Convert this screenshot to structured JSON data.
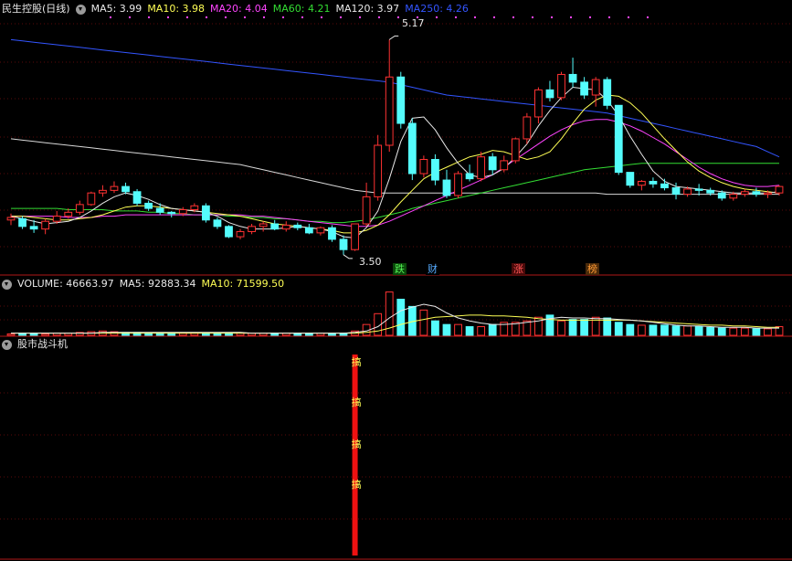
{
  "price_panel": {
    "title": "民生控股(日线)",
    "indicators": [
      {
        "name": "MA5",
        "value": "3.99",
        "color": "#e8e8e8"
      },
      {
        "name": "MA10",
        "value": "3.98",
        "color": "#ffff55"
      },
      {
        "name": "MA20",
        "value": "4.04",
        "color": "#ff44ff"
      },
      {
        "name": "MA60",
        "value": "4.21",
        "color": "#33dd33"
      },
      {
        "name": "MA120",
        "value": "3.97",
        "color": "#e8e8e8"
      },
      {
        "name": "MA250",
        "value": "4.26",
        "color": "#3355ff"
      }
    ],
    "high_marker": "5.17",
    "low_marker": "3.50",
    "event_badges": [
      {
        "text": "跌",
        "color": "#55ee55",
        "bg": "#0a4a0a"
      },
      {
        "text": "财",
        "color": "#55aaff",
        "bg": "#000"
      },
      {
        "text": "涨",
        "color": "#ff5555",
        "bg": "#4a0a0a"
      },
      {
        "text": "榜",
        "color": "#ff9933",
        "bg": "#4a2a0a"
      }
    ]
  },
  "volume_panel": {
    "indicators": [
      {
        "name": "VOLUME",
        "value": "46663.97",
        "color": "#e8e8e8"
      },
      {
        "name": "MA5",
        "value": "92883.34",
        "color": "#e8e8e8"
      },
      {
        "name": "MA10",
        "value": "71599.50",
        "color": "#ffff55"
      }
    ]
  },
  "custom_panel": {
    "title": "股市战斗机",
    "signal_text": "搞"
  },
  "chart_data": {
    "type": "candlestick",
    "ylim": [
      3.35,
      5.35
    ],
    "candles": [
      [
        3.77,
        3.82,
        3.73,
        3.79
      ],
      [
        3.78,
        3.8,
        3.7,
        3.72
      ],
      [
        3.72,
        3.77,
        3.67,
        3.7
      ],
      [
        3.7,
        3.78,
        3.66,
        3.76
      ],
      [
        3.76,
        3.84,
        3.74,
        3.8
      ],
      [
        3.8,
        3.86,
        3.78,
        3.83
      ],
      [
        3.83,
        3.92,
        3.81,
        3.89
      ],
      [
        3.89,
        3.99,
        3.88,
        3.98
      ],
      [
        3.98,
        4.04,
        3.95,
        4.0
      ],
      [
        4.0,
        4.07,
        3.98,
        4.03
      ],
      [
        4.03,
        4.06,
        3.97,
        3.99
      ],
      [
        3.99,
        4.01,
        3.88,
        3.9
      ],
      [
        3.9,
        3.92,
        3.84,
        3.86
      ],
      [
        3.86,
        3.9,
        3.81,
        3.83
      ],
      [
        3.83,
        3.84,
        3.79,
        3.82
      ],
      [
        3.82,
        3.87,
        3.8,
        3.85
      ],
      [
        3.85,
        3.9,
        3.83,
        3.88
      ],
      [
        3.88,
        3.9,
        3.75,
        3.77
      ],
      [
        3.77,
        3.79,
        3.7,
        3.72
      ],
      [
        3.72,
        3.73,
        3.63,
        3.64
      ],
      [
        3.64,
        3.7,
        3.62,
        3.68
      ],
      [
        3.68,
        3.74,
        3.66,
        3.72
      ],
      [
        3.72,
        3.76,
        3.68,
        3.74
      ],
      [
        3.74,
        3.77,
        3.69,
        3.7
      ],
      [
        3.7,
        3.76,
        3.68,
        3.73
      ],
      [
        3.73,
        3.75,
        3.69,
        3.71
      ],
      [
        3.71,
        3.74,
        3.66,
        3.67
      ],
      [
        3.67,
        3.72,
        3.65,
        3.71
      ],
      [
        3.71,
        3.73,
        3.6,
        3.62
      ],
      [
        3.62,
        3.65,
        3.5,
        3.54
      ],
      [
        3.54,
        3.74,
        3.53,
        3.74
      ],
      [
        3.74,
        4.06,
        3.72,
        3.95
      ],
      [
        3.95,
        4.43,
        3.92,
        4.35
      ],
      [
        4.35,
        5.17,
        4.3,
        4.88
      ],
      [
        4.88,
        4.92,
        4.48,
        4.52
      ],
      [
        4.52,
        4.56,
        4.08,
        4.13
      ],
      [
        4.13,
        4.27,
        4.1,
        4.24
      ],
      [
        4.24,
        4.28,
        4.04,
        4.08
      ],
      [
        4.08,
        4.16,
        3.94,
        3.96
      ],
      [
        3.96,
        4.15,
        3.94,
        4.13
      ],
      [
        4.13,
        4.2,
        4.07,
        4.09
      ],
      [
        4.09,
        4.3,
        4.07,
        4.26
      ],
      [
        4.26,
        4.29,
        4.12,
        4.16
      ],
      [
        4.16,
        4.27,
        4.14,
        4.23
      ],
      [
        4.23,
        4.41,
        4.21,
        4.4
      ],
      [
        4.4,
        4.6,
        4.36,
        4.57
      ],
      [
        4.57,
        4.8,
        4.52,
        4.78
      ],
      [
        4.78,
        4.85,
        4.69,
        4.72
      ],
      [
        4.72,
        4.92,
        4.7,
        4.9
      ],
      [
        4.9,
        5.03,
        4.8,
        4.84
      ],
      [
        4.84,
        4.88,
        4.71,
        4.74
      ],
      [
        4.74,
        4.88,
        4.65,
        4.86
      ],
      [
        4.86,
        4.88,
        4.63,
        4.66
      ],
      [
        4.66,
        4.2,
        4.12,
        4.14
      ],
      [
        4.14,
        4.14,
        4.02,
        4.04
      ],
      [
        4.04,
        4.08,
        4.0,
        4.07
      ],
      [
        4.07,
        4.1,
        4.02,
        4.05
      ],
      [
        4.05,
        4.09,
        4.0,
        4.02
      ],
      [
        4.02,
        4.06,
        3.93,
        3.97
      ],
      [
        3.97,
        4.03,
        3.95,
        4.01
      ],
      [
        4.01,
        4.05,
        3.96,
        4.0
      ],
      [
        4.0,
        4.02,
        3.96,
        3.98
      ],
      [
        3.98,
        4.0,
        3.92,
        3.94
      ],
      [
        3.94,
        3.99,
        3.92,
        3.97
      ],
      [
        3.97,
        4.01,
        3.95,
        3.99
      ],
      [
        3.99,
        4.02,
        3.95,
        3.97
      ],
      [
        3.97,
        4.0,
        3.94,
        3.98
      ],
      [
        3.98,
        4.04,
        3.96,
        4.03
      ]
    ],
    "ma5": [
      3.8,
      3.78,
      3.76,
      3.74,
      3.75,
      3.76,
      3.79,
      3.84,
      3.9,
      3.95,
      3.98,
      3.96,
      3.93,
      3.89,
      3.86,
      3.85,
      3.84,
      3.83,
      3.8,
      3.75,
      3.72,
      3.7,
      3.7,
      3.7,
      3.71,
      3.72,
      3.71,
      3.7,
      3.68,
      3.64,
      3.63,
      3.71,
      3.84,
      4.09,
      4.38,
      4.56,
      4.57,
      4.47,
      4.33,
      4.21,
      4.12,
      4.1,
      4.12,
      4.17,
      4.26,
      4.36,
      4.5,
      4.62,
      4.72,
      4.8,
      4.79,
      4.78,
      4.7,
      4.58,
      4.42,
      4.28,
      4.15,
      4.07,
      4.03,
      4.02,
      4.01,
      4.0,
      3.99,
      3.98,
      3.98,
      3.98,
      3.98,
      3.99
    ],
    "ma10": [
      3.8,
      3.8,
      3.79,
      3.78,
      3.77,
      3.77,
      3.78,
      3.79,
      3.81,
      3.84,
      3.87,
      3.88,
      3.88,
      3.87,
      3.86,
      3.85,
      3.84,
      3.83,
      3.82,
      3.81,
      3.8,
      3.78,
      3.76,
      3.74,
      3.73,
      3.72,
      3.71,
      3.7,
      3.69,
      3.67,
      3.67,
      3.69,
      3.73,
      3.81,
      3.91,
      4.0,
      4.09,
      4.14,
      4.18,
      4.22,
      4.26,
      4.28,
      4.31,
      4.3,
      4.27,
      4.24,
      4.26,
      4.3,
      4.4,
      4.52,
      4.63,
      4.7,
      4.74,
      4.73,
      4.68,
      4.6,
      4.5,
      4.4,
      4.31,
      4.22,
      4.15,
      4.1,
      4.06,
      4.03,
      4.01,
      4.0,
      3.99,
      3.98
    ],
    "ma20": [
      3.8,
      3.8,
      3.8,
      3.8,
      3.8,
      3.79,
      3.79,
      3.79,
      3.8,
      3.8,
      3.81,
      3.81,
      3.81,
      3.81,
      3.81,
      3.81,
      3.81,
      3.81,
      3.81,
      3.81,
      3.81,
      3.8,
      3.8,
      3.79,
      3.78,
      3.77,
      3.76,
      3.75,
      3.74,
      3.73,
      3.72,
      3.72,
      3.73,
      3.76,
      3.8,
      3.84,
      3.88,
      3.92,
      3.96,
      4.0,
      4.04,
      4.08,
      4.12,
      4.18,
      4.24,
      4.3,
      4.36,
      4.42,
      4.47,
      4.51,
      4.54,
      4.55,
      4.55,
      4.53,
      4.5,
      4.46,
      4.41,
      4.36,
      4.3,
      4.24,
      4.18,
      4.13,
      4.09,
      4.06,
      4.04,
      4.03,
      4.03,
      4.04
    ],
    "ma60": [
      3.86,
      3.86,
      3.86,
      3.86,
      3.86,
      3.85,
      3.85,
      3.85,
      3.85,
      3.84,
      3.84,
      3.84,
      3.83,
      3.83,
      3.82,
      3.82,
      3.81,
      3.81,
      3.81,
      3.8,
      3.8,
      3.79,
      3.79,
      3.78,
      3.78,
      3.77,
      3.76,
      3.76,
      3.75,
      3.75,
      3.76,
      3.77,
      3.79,
      3.81,
      3.83,
      3.86,
      3.88,
      3.9,
      3.92,
      3.94,
      3.96,
      3.98,
      4.0,
      4.02,
      4.04,
      4.06,
      4.08,
      4.1,
      4.12,
      4.14,
      4.16,
      4.17,
      4.18,
      4.19,
      4.2,
      4.21,
      4.21,
      4.21,
      4.21,
      4.21,
      4.21,
      4.21,
      4.21,
      4.21,
      4.21,
      4.21,
      4.21,
      4.21
    ],
    "ma120": [
      4.4,
      4.39,
      4.38,
      4.37,
      4.36,
      4.35,
      4.34,
      4.33,
      4.32,
      4.31,
      4.3,
      4.29,
      4.28,
      4.27,
      4.26,
      4.25,
      4.24,
      4.23,
      4.22,
      4.21,
      4.2,
      4.18,
      4.16,
      4.14,
      4.12,
      4.1,
      4.08,
      4.06,
      4.04,
      4.02,
      4.0,
      3.99,
      3.98,
      3.98,
      3.98,
      3.98,
      3.98,
      3.98,
      3.98,
      3.98,
      3.98,
      3.98,
      3.98,
      3.98,
      3.98,
      3.98,
      3.98,
      3.98,
      3.98,
      3.98,
      3.98,
      3.98,
      3.97,
      3.97,
      3.97,
      3.97,
      3.97,
      3.97,
      3.97,
      3.97,
      3.97,
      3.97,
      3.97,
      3.97,
      3.97,
      3.97,
      3.97,
      3.97
    ],
    "ma250": [
      5.17,
      5.16,
      5.15,
      5.14,
      5.13,
      5.12,
      5.11,
      5.1,
      5.09,
      5.08,
      5.07,
      5.06,
      5.05,
      5.04,
      5.03,
      5.02,
      5.01,
      5.0,
      4.99,
      4.98,
      4.97,
      4.96,
      4.95,
      4.94,
      4.93,
      4.92,
      4.91,
      4.9,
      4.89,
      4.88,
      4.87,
      4.86,
      4.85,
      4.84,
      4.82,
      4.8,
      4.78,
      4.76,
      4.74,
      4.73,
      4.72,
      4.71,
      4.7,
      4.69,
      4.68,
      4.67,
      4.66,
      4.65,
      4.64,
      4.63,
      4.62,
      4.61,
      4.6,
      4.58,
      4.56,
      4.54,
      4.52,
      4.5,
      4.48,
      4.46,
      4.44,
      4.42,
      4.4,
      4.38,
      4.36,
      4.34,
      4.3,
      4.26
    ],
    "volume": [
      2,
      3,
      3,
      2,
      3,
      3,
      4,
      5,
      6,
      5,
      4,
      4,
      3,
      3,
      3,
      3,
      3,
      3,
      3,
      3,
      3,
      3,
      3,
      3,
      3,
      3,
      3,
      3,
      2,
      3,
      6,
      15,
      30,
      60,
      50,
      40,
      35,
      20,
      15,
      15,
      12,
      12,
      15,
      18,
      18,
      20,
      25,
      28,
      20,
      22,
      22,
      25,
      24,
      18,
      15,
      14,
      14,
      14,
      13,
      13,
      12,
      11,
      10,
      10,
      10,
      9,
      9,
      12
    ],
    "vol_ma5": [
      3,
      3,
      3,
      3,
      3,
      3,
      3,
      3,
      4,
      4,
      4,
      4,
      4,
      4,
      4,
      4,
      4,
      4,
      4,
      4,
      4,
      3,
      3,
      3,
      3,
      3,
      3,
      3,
      3,
      3,
      4,
      6,
      12,
      24,
      34,
      39,
      43,
      40,
      31,
      24,
      20,
      17,
      15,
      15,
      16,
      18,
      20,
      23,
      25,
      24,
      24,
      23,
      23,
      22,
      21,
      20,
      18,
      16,
      14,
      13,
      13,
      12,
      11,
      11,
      11,
      10,
      10,
      10
    ],
    "vol_ma10": [
      3,
      3,
      3,
      3,
      3,
      3,
      3,
      3,
      3,
      3,
      3,
      3,
      3,
      3,
      3,
      3,
      3,
      3,
      3,
      3,
      3,
      3,
      3,
      3,
      3,
      3,
      3,
      3,
      3,
      3,
      3,
      4,
      6,
      10,
      15,
      19,
      22,
      25,
      26,
      27,
      28,
      28,
      27,
      27,
      26,
      25,
      23,
      22,
      21,
      21,
      21,
      21,
      21,
      21,
      21,
      20,
      19,
      18,
      17,
      16,
      15,
      14,
      14,
      13,
      13,
      12,
      11,
      11
    ],
    "vol_ylim": [
      0,
      62
    ],
    "signal_bar_index": 30
  }
}
